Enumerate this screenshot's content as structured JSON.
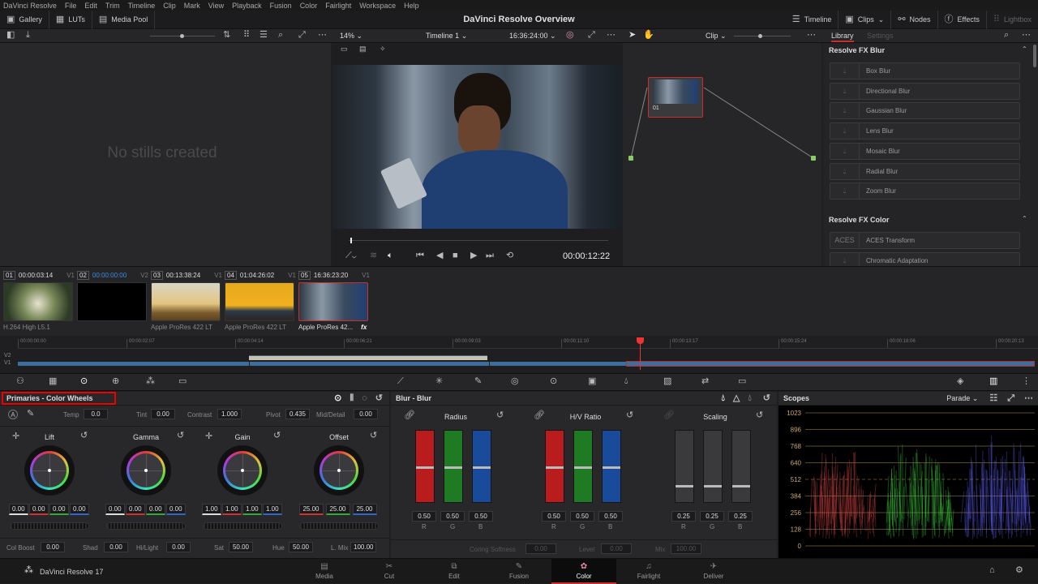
{
  "menu": [
    "DaVinci Resolve",
    "File",
    "Edit",
    "Trim",
    "Timeline",
    "Clip",
    "Mark",
    "View",
    "Playback",
    "Fusion",
    "Color",
    "Fairlight",
    "Workspace",
    "Help"
  ],
  "topbar": {
    "title": "DaVinci Resolve Overview",
    "left": [
      "Gallery",
      "LUTs",
      "Media Pool"
    ],
    "right": [
      "Timeline",
      "Clips",
      "Nodes",
      "Effects",
      "Lightbox"
    ]
  },
  "viewer": {
    "zoom": "14%",
    "timeline": "Timeline 1",
    "timecode": "16:36:24:00",
    "current": "00:00:12:22",
    "clip_mode": "Clip"
  },
  "gallery": {
    "empty": "No stills created"
  },
  "library": {
    "tabs": [
      "Library",
      "Settings"
    ],
    "sections": [
      {
        "title": "Resolve FX Blur",
        "items": [
          "Box Blur",
          "Directional Blur",
          "Gaussian Blur",
          "Lens Blur",
          "Mosaic Blur",
          "Radial Blur",
          "Zoom Blur"
        ]
      },
      {
        "title": "Resolve FX Color",
        "items": [
          "ACES Transform",
          "Chromatic Adaptation"
        ]
      }
    ]
  },
  "node": {
    "label": "01"
  },
  "clips": [
    {
      "num": "01",
      "tc": "00:00:03:14",
      "track": "V1",
      "codec": "H.264 High L5.1"
    },
    {
      "num": "02",
      "tc": "00:00:00:00",
      "track": "V2",
      "codec": ""
    },
    {
      "num": "03",
      "tc": "00:13:38:24",
      "track": "V1",
      "codec": "Apple ProRes 422 LT"
    },
    {
      "num": "04",
      "tc": "01:04:26:02",
      "track": "V1",
      "codec": "Apple ProRes 422 LT"
    },
    {
      "num": "05",
      "tc": "16:36:23:20",
      "track": "V1",
      "codec": "Apple ProRes 42...",
      "fx": "fx"
    }
  ],
  "timeline": {
    "ruler": [
      "00:00:00:00",
      "00:00:02:07",
      "00:00:04:14",
      "00:00:06:21",
      "00:00:09:03",
      "00:00:11:10",
      "00:00:13:17",
      "00:00:15:24",
      "00:00:18:06",
      "00:00:20:13"
    ],
    "tracks": [
      "V2",
      "V1"
    ],
    "playhead_fraction": 0.61
  },
  "primaries": {
    "title": "Primaries - Color Wheels",
    "temp": {
      "label": "Temp",
      "value": "0.0"
    },
    "tint": {
      "label": "Tint",
      "value": "0.00"
    },
    "contrast": {
      "label": "Contrast",
      "value": "1.000"
    },
    "pivot": {
      "label": "Pivot",
      "value": "0.435"
    },
    "mid": {
      "label": "Mid/Detail",
      "value": "0.00"
    },
    "wheels": [
      {
        "name": "Lift",
        "values": [
          "0.00",
          "0.00",
          "0.00",
          "0.00"
        ]
      },
      {
        "name": "Gamma",
        "values": [
          "0.00",
          "0.00",
          "0.00",
          "0.00"
        ]
      },
      {
        "name": "Gain",
        "values": [
          "1.00",
          "1.00",
          "1.00",
          "1.00"
        ]
      },
      {
        "name": "Offset",
        "values": [
          "25.00",
          "25.00",
          "25.00"
        ]
      }
    ],
    "bottom": [
      {
        "label": "Col Boost",
        "value": "0.00"
      },
      {
        "label": "Shad",
        "value": "0.00"
      },
      {
        "label": "Hi/Light",
        "value": "0.00"
      },
      {
        "label": "Sat",
        "value": "50.00"
      },
      {
        "label": "Hue",
        "value": "50.00"
      },
      {
        "label": "L. Mix",
        "value": "100.00"
      }
    ]
  },
  "blur": {
    "title": "Blur - Blur",
    "groups": [
      {
        "name": "Radius",
        "values": [
          "0.50",
          "0.50",
          "0.50"
        ],
        "level": 0.5
      },
      {
        "name": "H/V Ratio",
        "values": [
          "0.50",
          "0.50",
          "0.50"
        ],
        "level": 0.5
      },
      {
        "name": "Scaling",
        "values": [
          "0.25",
          "0.25",
          "0.25"
        ],
        "level": 0.25
      }
    ],
    "channels": [
      "R",
      "G",
      "B"
    ],
    "coring": {
      "label": "Coring Softness",
      "value": "0.00"
    },
    "level": {
      "label": "Level",
      "value": "0.00"
    },
    "mix": {
      "label": "Mix",
      "value": "100.00"
    }
  },
  "scopes": {
    "title": "Scopes",
    "mode": "Parade",
    "ticks": [
      "1023",
      "896",
      "768",
      "640",
      "512",
      "384",
      "256",
      "128",
      "0"
    ]
  },
  "nav": {
    "app": "DaVinci Resolve 17",
    "pages": [
      "Media",
      "Cut",
      "Edit",
      "Fusion",
      "Color",
      "Fairlight",
      "Deliver"
    ],
    "active": "Color"
  },
  "colors": {
    "accent": "#c63030",
    "highlight": "#e00000"
  }
}
